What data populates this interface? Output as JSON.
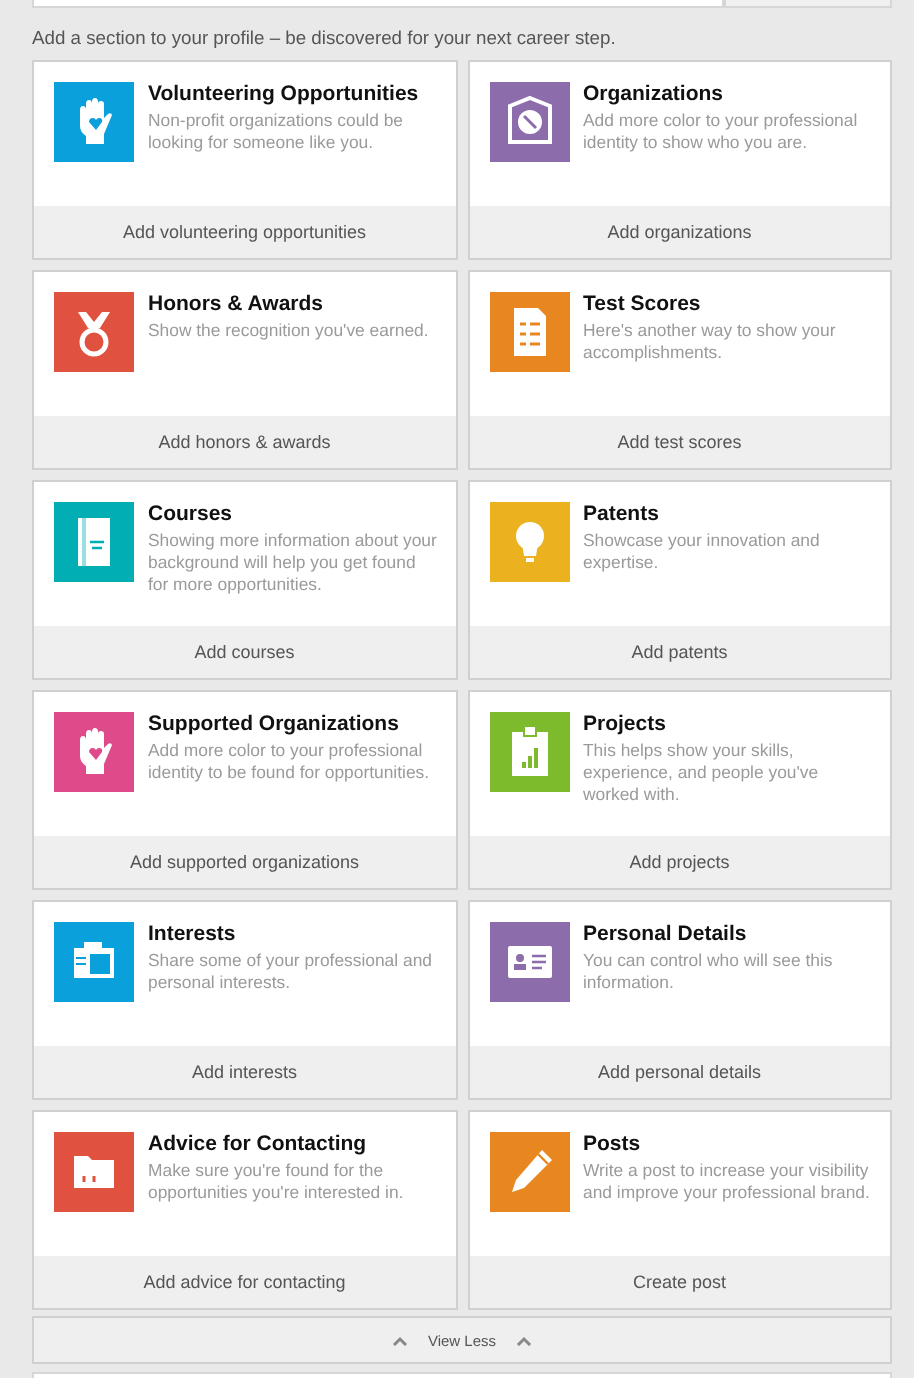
{
  "intro": "Add a section to your profile – be discovered for your next career step.",
  "sections": [
    {
      "kind": "volunteering",
      "color": "#0aa0dc",
      "title": "Volunteering Opportunities",
      "description": "Non-profit organizations could be looking for someone like you.",
      "action": "Add volunteering opportunities"
    },
    {
      "kind": "organizations",
      "color": "#8d6cab",
      "title": "Organizations",
      "description": "Add more color to your professional identity to show who you are.",
      "action": "Add organizations"
    },
    {
      "kind": "honors",
      "color": "#e0523f",
      "title": "Honors & Awards",
      "description": "Show the recognition you've earned.",
      "action": "Add honors & awards"
    },
    {
      "kind": "tests",
      "color": "#e88720",
      "title": "Test Scores",
      "description": "Here's another way to show your accomplishments.",
      "action": "Add test scores"
    },
    {
      "kind": "courses",
      "color": "#00aeb3",
      "title": "Courses",
      "description": "Showing more information about your background will help you get found for more opportunities.",
      "action": "Add courses"
    },
    {
      "kind": "patents",
      "color": "#ebb11f",
      "title": "Patents",
      "description": "Showcase your innovation and expertise.",
      "action": "Add patents"
    },
    {
      "kind": "supported",
      "color": "#df4a8a",
      "title": "Supported Organizations",
      "description": "Add more color to your professional identity to be found for opportunities.",
      "action": "Add supported organizations"
    },
    {
      "kind": "projects",
      "color": "#7dbb2c",
      "title": "Projects",
      "description": "This helps show your skills, experience, and people you've worked with.",
      "action": "Add projects"
    },
    {
      "kind": "interests",
      "color": "#0aa0dc",
      "title": "Interests",
      "description": "Share some of your professional and personal interests.",
      "action": "Add interests"
    },
    {
      "kind": "personal",
      "color": "#8d6cab",
      "title": "Personal Details",
      "description": "You can control who will see this information.",
      "action": "Add personal details"
    },
    {
      "kind": "advice",
      "color": "#e0523f",
      "title": "Advice for Contacting",
      "description": "Make sure you're found for the opportunities you're interested in.",
      "action": "Add advice for contacting"
    },
    {
      "kind": "posts",
      "color": "#e88720",
      "title": "Posts",
      "description": "Write a post to increase your visibility and improve your professional brand.",
      "action": "Create post"
    }
  ],
  "toggle": {
    "label": "View Less"
  }
}
